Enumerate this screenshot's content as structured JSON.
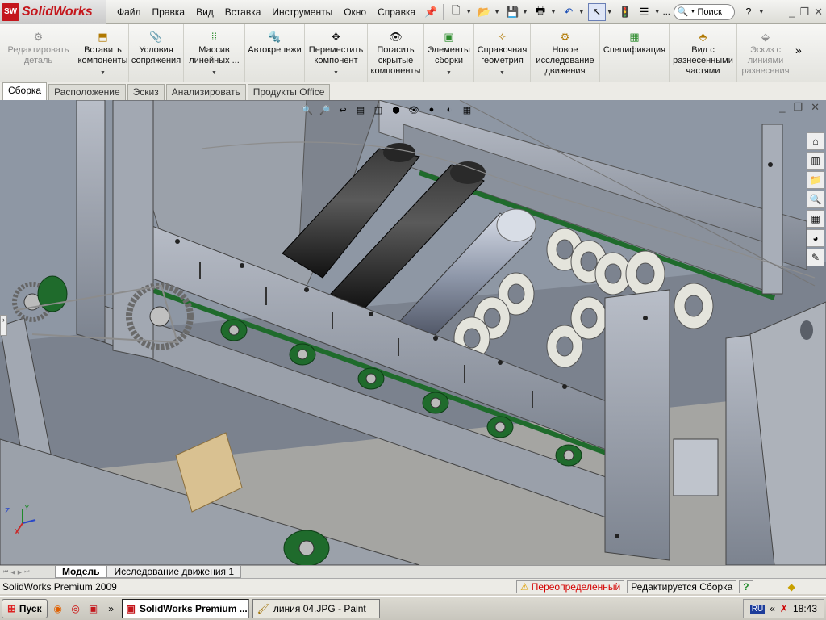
{
  "app": {
    "logo_text": "SolidWorks",
    "logo_badge": "SW"
  },
  "menu": [
    "Файл",
    "Правка",
    "Вид",
    "Вставка",
    "Инструменты",
    "Окно",
    "Справка"
  ],
  "toolbar": {
    "search_label": "Поиск",
    "truncated_label": "..."
  },
  "command_manager": [
    {
      "label": "Редактировать деталь",
      "icon": "edit-part-icon",
      "disabled": true,
      "dropdown": false
    },
    {
      "label": "Вставить компоненты",
      "icon": "insert-components-icon",
      "disabled": false,
      "dropdown": true
    },
    {
      "label": "Условия сопряжения",
      "icon": "mate-icon",
      "disabled": false,
      "dropdown": false
    },
    {
      "label": "Массив линейных ...",
      "icon": "linear-pattern-icon",
      "disabled": false,
      "dropdown": true
    },
    {
      "label": "Автокрепежи",
      "icon": "smart-fasteners-icon",
      "disabled": false,
      "dropdown": false
    },
    {
      "label": "Переместить компонент",
      "icon": "move-component-icon",
      "disabled": false,
      "dropdown": true
    },
    {
      "label": "Погасить скрытые компоненты",
      "icon": "hide-components-icon",
      "disabled": false,
      "dropdown": false
    },
    {
      "label": "Элементы сборки",
      "icon": "assembly-features-icon",
      "disabled": false,
      "dropdown": true
    },
    {
      "label": "Справочная геометрия",
      "icon": "reference-geometry-icon",
      "disabled": false,
      "dropdown": true
    },
    {
      "label": "Новое исследование движения",
      "icon": "motion-study-icon",
      "disabled": false,
      "dropdown": false
    },
    {
      "label": "Спецификация",
      "icon": "bom-icon",
      "disabled": false,
      "dropdown": false
    },
    {
      "label": "Вид с разнесенными частями",
      "icon": "exploded-view-icon",
      "disabled": false,
      "dropdown": false
    },
    {
      "label": "Эскиз с линиями разнесения",
      "icon": "explode-line-sketch-icon",
      "disabled": true,
      "dropdown": false
    }
  ],
  "tabs": [
    {
      "label": "Сборка",
      "active": true
    },
    {
      "label": "Расположение",
      "active": false
    },
    {
      "label": "Эскиз",
      "active": false
    },
    {
      "label": "Анализировать",
      "active": false
    },
    {
      "label": "Продукты Office",
      "active": false
    }
  ],
  "bottom_tabs": [
    {
      "label": "Модель",
      "active": true
    },
    {
      "label": "Исследование движения 1",
      "active": false
    }
  ],
  "status_bar": {
    "version": "SolidWorks Premium 2009",
    "state": "Переопределенный",
    "editing": "Редактируется Сборка"
  },
  "taskbar": {
    "start_label": "Пуск",
    "tasks": [
      {
        "label": "SolidWorks Premium ...",
        "active": true
      },
      {
        "label": "линия 04.JPG - Paint",
        "active": false
      }
    ],
    "language": "RU",
    "clock": "18:43"
  },
  "triad": {
    "x": "X",
    "y": "Y",
    "z": "Z"
  },
  "colors": {
    "logo_red": "#c4161c",
    "viewport_bg": "#8e97a4",
    "bearing_green": "#1f6b2c",
    "warning_red": "#d40000"
  }
}
